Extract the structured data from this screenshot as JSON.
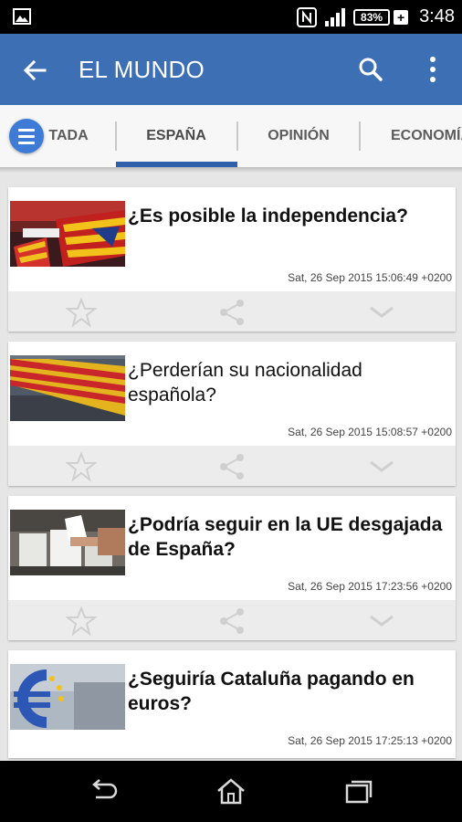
{
  "status_bar": {
    "battery_text": "83%",
    "battery_plus": "+",
    "clock": "3:48",
    "icons": [
      "gallery-icon",
      "nfc-icon",
      "signal-icon",
      "battery-icon"
    ]
  },
  "app_bar": {
    "title": "EL MUNDO",
    "color": "#3d6fb5",
    "icons": [
      "back-arrow-icon",
      "search-icon",
      "overflow-menu-icon"
    ]
  },
  "tabs": {
    "items": [
      {
        "label": "TADA"
      },
      {
        "label": "ESPAÑA",
        "selected": true
      },
      {
        "label": "OPINIÓN"
      },
      {
        "label": "ECONOMÍA"
      }
    ],
    "indicator_color": "#2f5fa8"
  },
  "articles": [
    {
      "headline": "¿Es posible la independencia?",
      "date": "Sat, 26 Sep 2015 15:06:49 +0200",
      "bold": true,
      "image": "crowd-flags-image"
    },
    {
      "headline": "¿Perderían su nacionalidad española?",
      "date": "Sat, 26 Sep 2015 15:08:57 +0200",
      "bold": false,
      "image": "flag-crowd-image"
    },
    {
      "headline": "¿Podría seguir en la UE desgajada de España?",
      "date": "Sat, 26 Sep 2015 17:23:56 +0200",
      "bold": true,
      "image": "ballot-box-image"
    },
    {
      "headline": "¿Seguiría Cataluña pagando en euros?",
      "date": "Sat, 26 Sep 2015 17:25:13 +0200",
      "bold": true,
      "image": "euro-sculpture-image"
    }
  ],
  "card_actions": [
    "star-icon",
    "share-icon",
    "chevron-down-icon"
  ],
  "nav_bar": [
    "back-nav-icon",
    "home-icon",
    "recents-icon"
  ]
}
